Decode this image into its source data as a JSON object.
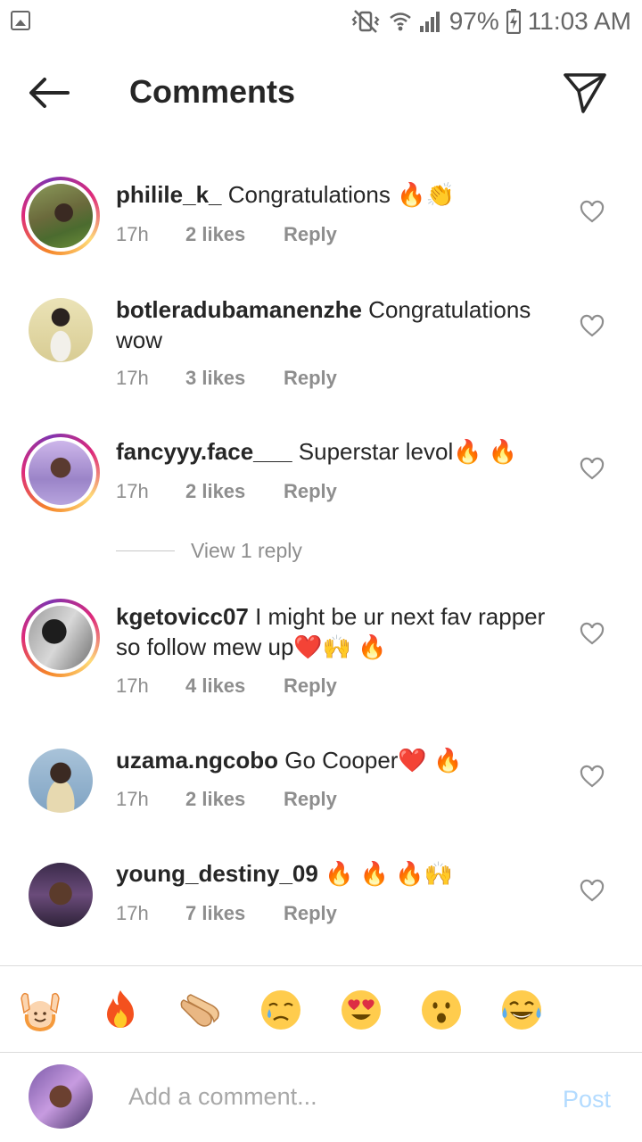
{
  "status_bar": {
    "battery": "97%",
    "time": "11:03 AM"
  },
  "header": {
    "title": "Comments"
  },
  "comments": [
    {
      "username": "philile_k_",
      "text": "Congratulations 🔥👏",
      "time": "17h",
      "likes": "2 likes",
      "reply": "Reply"
    },
    {
      "username": "botleradubamanenzhe",
      "text": "Congratulations wow",
      "time": "17h",
      "likes": "3 likes",
      "reply": "Reply"
    },
    {
      "username": "fancyyy.face___",
      "text": "Superstar levol🔥 🔥",
      "time": "17h",
      "likes": "2 likes",
      "reply": "Reply"
    },
    {
      "username": "kgetovicc07",
      "text": "I might be ur next fav rapper so follow mew up❤️🙌 🔥",
      "time": "17h",
      "likes": "4 likes",
      "reply": "Reply"
    },
    {
      "username": "uzama.ngcobo",
      "text": "Go Cooper❤️ 🔥",
      "time": "17h",
      "likes": "2 likes",
      "reply": "Reply"
    },
    {
      "username": "young_destiny_09",
      "text": "🔥 🔥 🔥🙌",
      "time": "17h",
      "likes": "7 likes",
      "reply": "Reply"
    }
  ],
  "view_replies": "View 1 reply",
  "emoji_bar": [
    "🙌",
    "🔥",
    "👏",
    "😢",
    "😍",
    "😮",
    "😂"
  ],
  "compose": {
    "placeholder": "Add a comment...",
    "post": "Post"
  },
  "colors": {
    "meta_gray": "#8e8e8e",
    "post_disabled": "#b3dbff",
    "story_ring": "#dd2a7b"
  }
}
